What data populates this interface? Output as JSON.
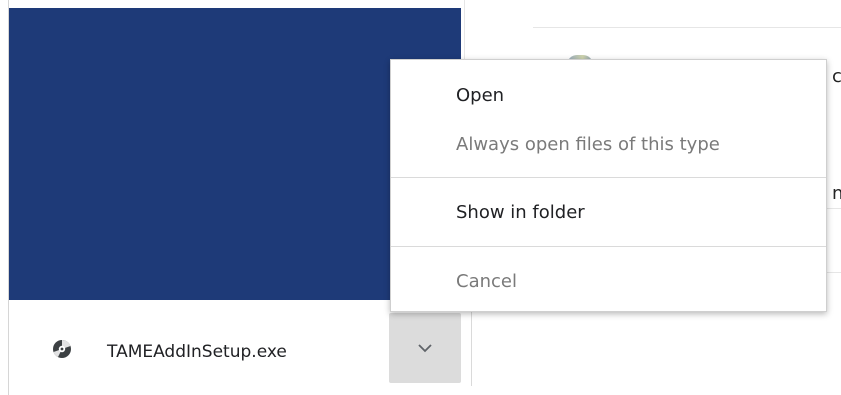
{
  "download_shelf": {
    "item": {
      "filename": "TAMEAddInSetup.exe",
      "icon": "installer-disc-icon",
      "menu_button_icon": "chevron-down-icon"
    }
  },
  "context_menu": {
    "items": [
      {
        "label": "Open",
        "enabled": true
      },
      {
        "label": "Always open files of this type",
        "enabled": false
      },
      {
        "label": "Show in folder",
        "enabled": true
      },
      {
        "label": "Cancel",
        "enabled": false
      }
    ]
  },
  "page": {
    "clipped_text_1": "c",
    "clipped_text_2": "n"
  },
  "colors": {
    "page_blue": "#1e3a78",
    "menu_button_bg": "#dcdcdc",
    "disabled_text": "#7a7a7a",
    "text": "#202124"
  }
}
